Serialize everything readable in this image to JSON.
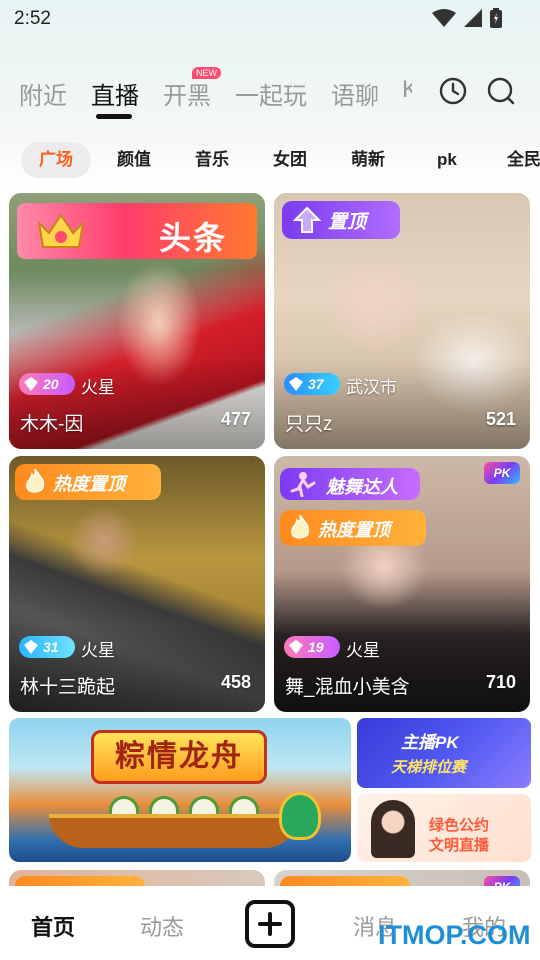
{
  "status_bar": {
    "time": "2:52",
    "icons": [
      "wifi-icon",
      "signal-icon",
      "battery-icon"
    ]
  },
  "top_tabs": [
    {
      "label": "附近"
    },
    {
      "label": "直播",
      "active": true
    },
    {
      "label": "开黑",
      "badge": "NEW"
    },
    {
      "label": "一起玩"
    },
    {
      "label": "语聊"
    },
    {
      "label": "K"
    }
  ],
  "top_icons": [
    "history-clock-icon",
    "search-icon"
  ],
  "categories": [
    {
      "label": "广场",
      "active": true
    },
    {
      "label": "颜值"
    },
    {
      "label": "音乐"
    },
    {
      "label": "女团"
    },
    {
      "label": "萌新"
    },
    {
      "label": "pk"
    },
    {
      "label": "全民"
    }
  ],
  "cards": [
    {
      "badge": "头条",
      "level": "20",
      "location": "火星",
      "name": "木木-因",
      "viewers": "477",
      "colors": {
        "level": "#c65cff"
      }
    },
    {
      "badge": "置顶",
      "level": "37",
      "location": "武汉市",
      "name": "只只z",
      "viewers": "521"
    },
    {
      "badge": "热度置顶",
      "level": "31",
      "location": "火星",
      "name": "林十三跪起",
      "viewers": "458"
    },
    {
      "badge": "魅舞达人",
      "badge2": "热度置顶",
      "pk": "PK",
      "level": "19",
      "location": "火星",
      "name": "舞_混血小美含",
      "viewers": "710"
    }
  ],
  "banners": {
    "main_title": "粽情龙舟",
    "pk_line1": "主播PK",
    "pk_line2": "天梯排位赛",
    "green_line1": "绿色公约",
    "green_line2": "文明直播"
  },
  "peek_cards": {
    "pk": "PK"
  },
  "bottom_nav": [
    {
      "label": "首页",
      "active": true
    },
    {
      "label": "动态"
    },
    {
      "label": "消息"
    },
    {
      "label": "我的"
    }
  ],
  "watermark": "ITMOP.COM",
  "colors": {
    "accent": "#ff5f1f",
    "hot": "#ff8a1e",
    "pin": "#7a3cf0",
    "headline": "#ff3d6c"
  }
}
